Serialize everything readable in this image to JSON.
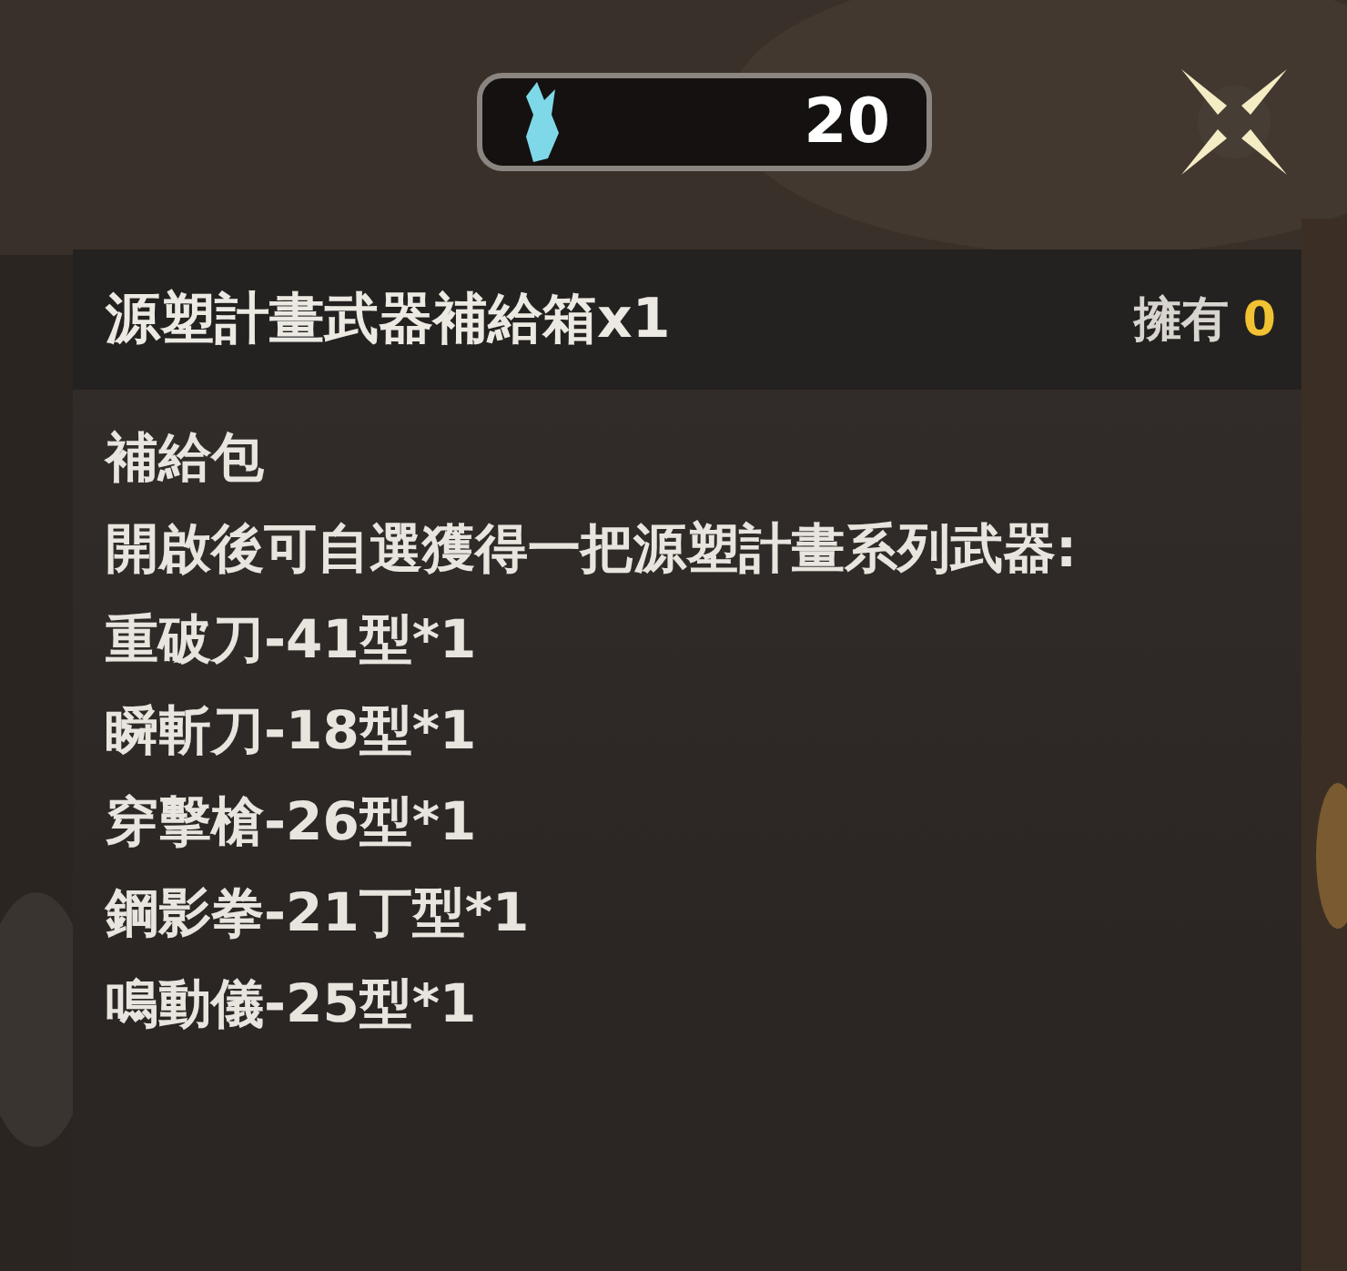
{
  "currency": {
    "amount": "20"
  },
  "item": {
    "title": "源塑計畫武器補給箱x1",
    "owned_label": "擁有",
    "owned_count": "0"
  },
  "description": {
    "type_line": "補給包",
    "text": "開啟後可自選獲得一把源塑計畫系列武器:",
    "contents": [
      "重破刀-41型*1",
      "瞬斬刀-18型*1",
      "穿擊槍-26型*1",
      "鋼影拳-21丁型*1",
      "鳴動儀-25型*1"
    ]
  }
}
